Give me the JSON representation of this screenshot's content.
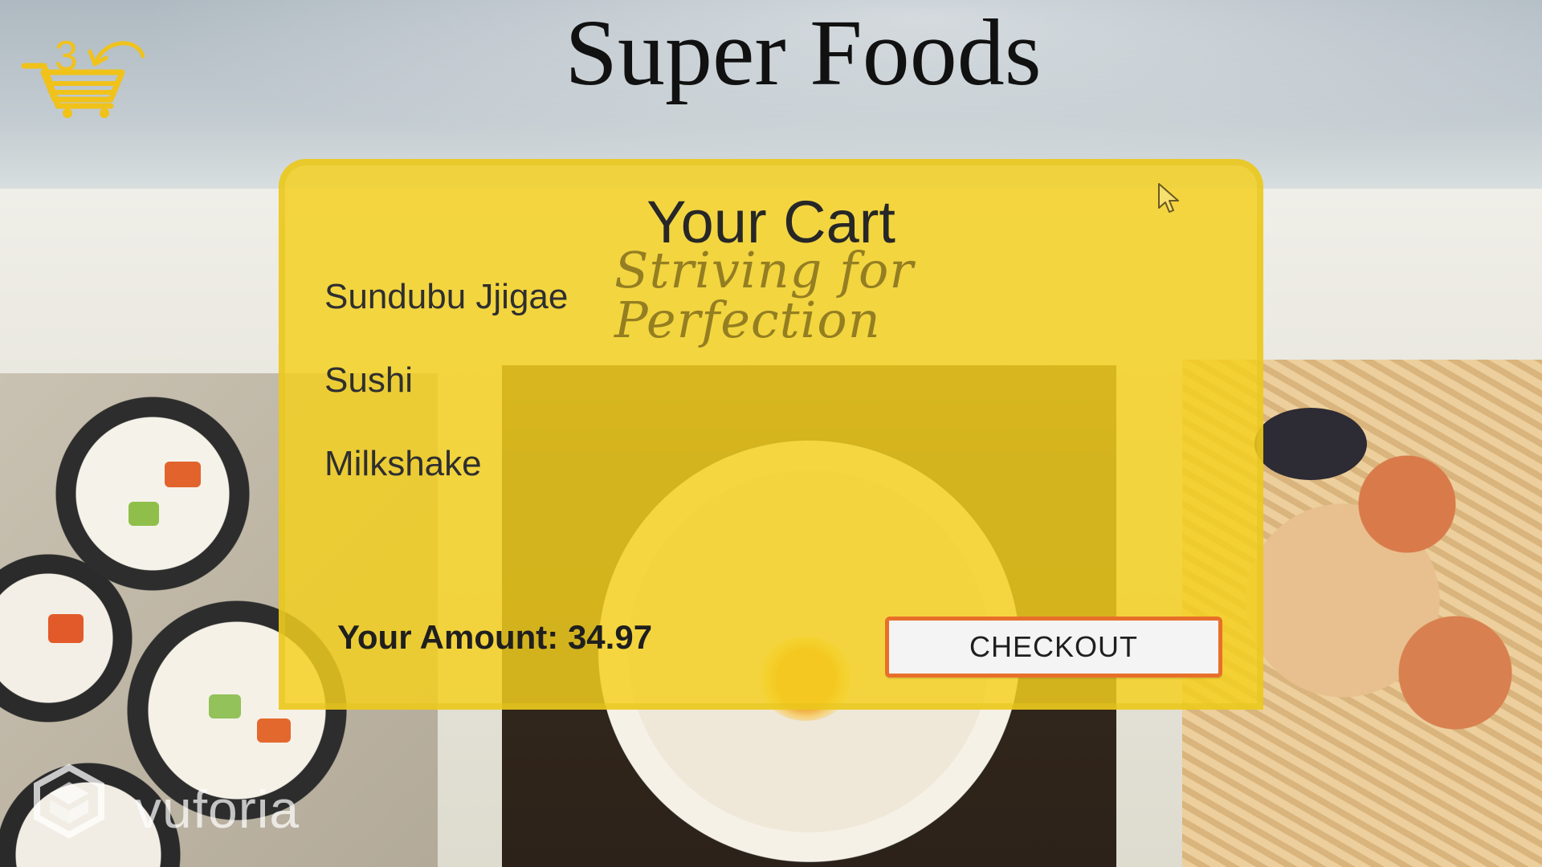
{
  "header": {
    "title": "Super Foods"
  },
  "cart_icon": {
    "icon": "shopping-cart-icon",
    "count": "3",
    "color": "#f0c21a"
  },
  "cart": {
    "title": "Your Cart",
    "items": [
      {
        "label": "Sundubu Jjigae"
      },
      {
        "label": "Sushi"
      },
      {
        "label": "Milkshake"
      }
    ],
    "amount_label": "Your Amount: 34.97",
    "checkout_label": "CHECKOUT",
    "panel_color": "#f4d01e",
    "button_border_color": "#e86f2a"
  },
  "background": {
    "tagline": "Striving for Perfection",
    "watermark": "vuforia"
  }
}
